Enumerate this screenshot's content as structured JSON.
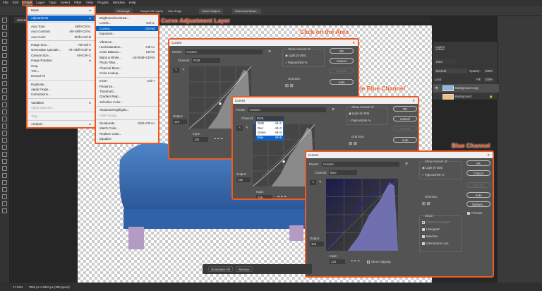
{
  "menubar": {
    "items": [
      "File",
      "Edit",
      "Image",
      "Layer",
      "Type",
      "Select",
      "Filter",
      "View",
      "Plugins",
      "Window",
      "Help"
    ]
  },
  "options": {
    "shape": "Rectangle",
    "sample_all": "Sample All Layers",
    "hard_edge": "Hard Edge",
    "select_subject": "Select Subject",
    "select_mask": "Select and Mask..."
  },
  "doc_tab": "desean",
  "image_menu": [
    {
      "label": "Mode",
      "shortcut": "",
      "arrow": true
    },
    {
      "sep": true
    },
    {
      "label": "Adjustments",
      "shortcut": "",
      "arrow": true,
      "selected": true
    },
    {
      "sep": true
    },
    {
      "label": "Auto Tone",
      "shortcut": "Shift+Ctrl+L"
    },
    {
      "label": "Auto Contrast",
      "shortcut": "Alt+Shift+Ctrl+L"
    },
    {
      "label": "Auto Color",
      "shortcut": "Shift+Ctrl+B"
    },
    {
      "sep": true
    },
    {
      "label": "Image Size...",
      "shortcut": "Alt+Ctrl+I"
    },
    {
      "label": "Generative Upscale...",
      "shortcut": "Alt+Shift+Ctrl+U"
    },
    {
      "label": "Canvas Size...",
      "shortcut": "Alt+Ctrl+C"
    },
    {
      "label": "Image Rotation",
      "shortcut": "",
      "arrow": true
    },
    {
      "label": "Crop",
      "shortcut": ""
    },
    {
      "label": "Trim...",
      "shortcut": ""
    },
    {
      "label": "Reveal All",
      "shortcut": ""
    },
    {
      "sep": true
    },
    {
      "label": "Duplicate...",
      "shortcut": ""
    },
    {
      "label": "Apply Image...",
      "shortcut": ""
    },
    {
      "label": "Calculations...",
      "shortcut": ""
    },
    {
      "sep": true
    },
    {
      "label": "Variables",
      "shortcut": "",
      "arrow": true
    },
    {
      "label": "Apply Data Set...",
      "shortcut": "",
      "disabled": true
    },
    {
      "sep": true
    },
    {
      "label": "Trap...",
      "shortcut": "",
      "disabled": true
    },
    {
      "sep": true
    },
    {
      "label": "Analysis",
      "shortcut": "",
      "arrow": true
    }
  ],
  "adjust_menu": [
    {
      "label": "Brightness/Contrast...",
      "shortcut": ""
    },
    {
      "label": "Levels...",
      "shortcut": "Ctrl+L"
    },
    {
      "label": "Curves...",
      "shortcut": "Ctrl+M",
      "selected": true
    },
    {
      "label": "Exposure...",
      "shortcut": ""
    },
    {
      "sep": true
    },
    {
      "label": "Vibrance...",
      "shortcut": ""
    },
    {
      "label": "Hue/Saturation...",
      "shortcut": "Ctrl+U"
    },
    {
      "label": "Color Balance...",
      "shortcut": "Ctrl+B"
    },
    {
      "label": "Black & White...",
      "shortcut": "Alt+Shift+Ctrl+B"
    },
    {
      "label": "Photo Filter...",
      "shortcut": ""
    },
    {
      "label": "Channel Mixer...",
      "shortcut": ""
    },
    {
      "label": "Color Lookup...",
      "shortcut": ""
    },
    {
      "sep": true
    },
    {
      "label": "Invert",
      "shortcut": "Ctrl+I"
    },
    {
      "label": "Posterize...",
      "shortcut": ""
    },
    {
      "label": "Threshold...",
      "shortcut": ""
    },
    {
      "label": "Gradient Map...",
      "shortcut": ""
    },
    {
      "label": "Selective Color...",
      "shortcut": ""
    },
    {
      "sep": true
    },
    {
      "label": "Shadows/Highlights...",
      "shortcut": ""
    },
    {
      "label": "HDR Toning...",
      "shortcut": "",
      "disabled": true
    },
    {
      "sep": true
    },
    {
      "label": "Desaturate",
      "shortcut": "Shift+Ctrl+U"
    },
    {
      "label": "Match Color...",
      "shortcut": ""
    },
    {
      "label": "Replace Color...",
      "shortcut": ""
    },
    {
      "label": "Equalize",
      "shortcut": ""
    }
  ],
  "callouts": {
    "c1": "Curve Adjustment Layer",
    "c2": "Click on the Area",
    "c3": "Move it from RGB to the Blue Channel",
    "c4": "Blue Channel"
  },
  "curves": {
    "title": "Curves",
    "close": "✕",
    "preset_label": "Preset:",
    "preset": "Custom",
    "channel_label": "Channel:",
    "show_amount": "Show Amount of:",
    "light": "Light  (0-255)",
    "pigment": "Pigment/Ink %",
    "grid_size": "Grid size:",
    "ok": "OK",
    "cancel": "Cancel",
    "smooth": "Smooth",
    "auto": "Auto",
    "options": "Options...",
    "preview": "Preview",
    "output_label": "Output:",
    "input_label": "Input:",
    "show_clipping": "Show Clipping",
    "show": "Show:",
    "channel_overlays": "Channel Overlays",
    "histogram": "Histogram",
    "baseline": "Baseline",
    "intersection": "Intersection Line",
    "d1": {
      "channel": "RGB",
      "output": "118",
      "input": "136"
    },
    "d2": {
      "channel": "RGB",
      "output": "118",
      "input": "136"
    },
    "d3": {
      "channel": "Blue",
      "output": "166",
      "input": "130"
    },
    "channel_options": [
      {
        "label": "RGB",
        "shortcut": "Alt+2"
      },
      {
        "label": "Red",
        "shortcut": "Alt+3"
      },
      {
        "label": "Green",
        "shortcut": "Alt+4"
      },
      {
        "label": "Blue",
        "shortcut": "Alt+5",
        "selected": true
      }
    ]
  },
  "layers": {
    "title": "Layers",
    "filter": "Kind",
    "blend": "Normal",
    "opacity_label": "Opacity:",
    "opacity": "100%",
    "lock_label": "Lock:",
    "fill_label": "Fill:",
    "fill": "100%",
    "items": [
      {
        "name": "Background copy",
        "visible": true,
        "selected": true
      },
      {
        "name": "Background",
        "visible": false,
        "locked": true
      }
    ]
  },
  "taskbar": {
    "gen_fill": "Generative Fill",
    "remove": "Remove"
  },
  "status": {
    "zoom": "17.02%",
    "size": "7952 px x 5304 px (300 ppcm)"
  },
  "colors": {
    "accent": "#ee5a24",
    "selection": "#0a64c8",
    "blue_curve": "#1a22c8"
  }
}
